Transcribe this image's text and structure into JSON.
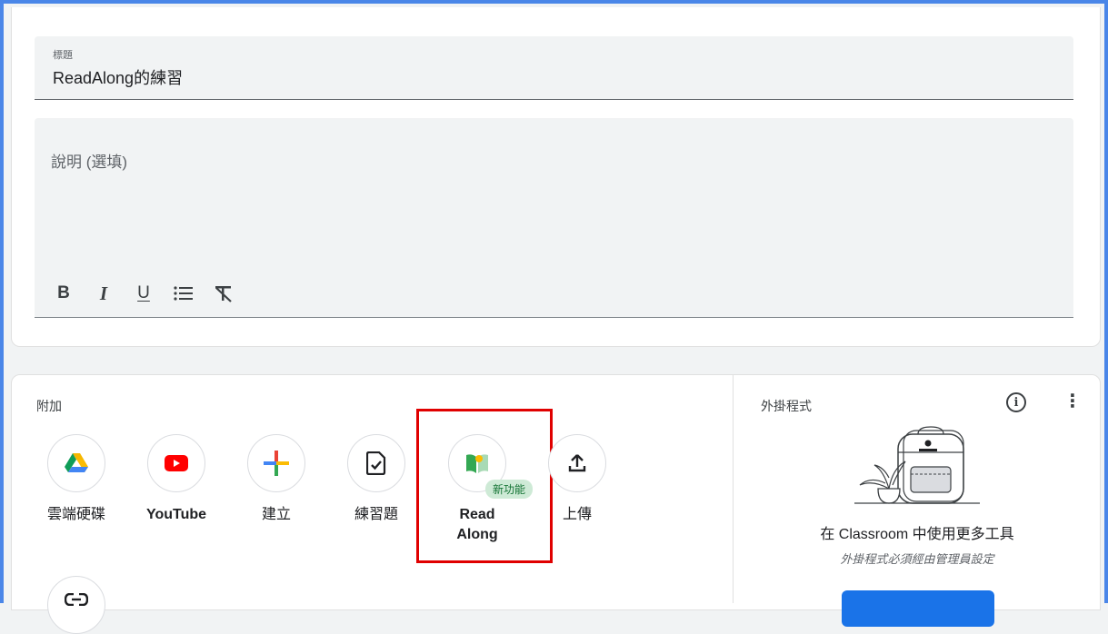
{
  "title_field": {
    "label": "標題",
    "value": "ReadAlong的練習"
  },
  "description_field": {
    "placeholder": "說明 (選填)"
  },
  "toolbar": [
    {
      "name": "bold-button",
      "glyph": "B"
    },
    {
      "name": "italic-button",
      "glyph": "I"
    },
    {
      "name": "underline-button",
      "glyph": "U"
    },
    {
      "name": "bulleted-list-button",
      "glyph": "☰"
    },
    {
      "name": "clear-formatting-button",
      "glyph": "T̸"
    }
  ],
  "attach": {
    "label": "附加",
    "items": [
      {
        "label": "雲端硬碟",
        "icon": "google-drive-icon"
      },
      {
        "label": "YouTube",
        "icon": "youtube-icon"
      },
      {
        "label": "建立",
        "icon": "create-plus-icon"
      },
      {
        "label": "練習題",
        "icon": "practice-set-icon"
      },
      {
        "label": "Read Along",
        "icon": "read-along-icon",
        "badge": "新功能"
      },
      {
        "label": "上傳",
        "icon": "upload-icon"
      }
    ],
    "link_icon": "link-icon"
  },
  "addons": {
    "title": "外掛程式",
    "main_text": "在 Classroom 中使用更多工具",
    "sub_text": "外掛程式必須經由管理員設定"
  },
  "colors": {
    "accent": "#1a73e8",
    "highlight": "#e00000",
    "badge_bg": "#ceead6",
    "badge_text": "#137333",
    "frame": "#4a86e8"
  }
}
